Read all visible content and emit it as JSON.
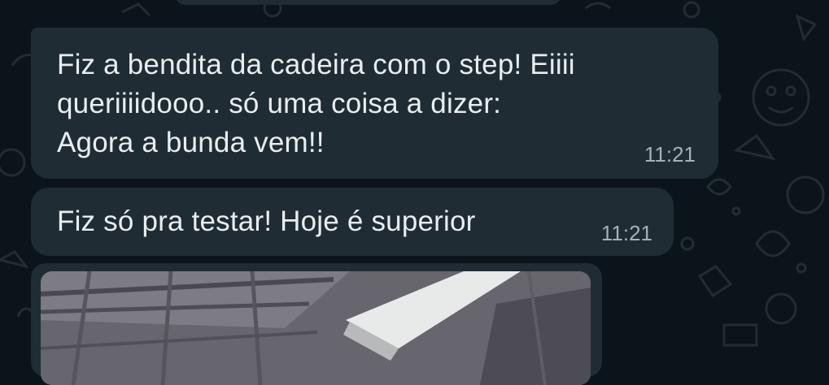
{
  "chat": {
    "messages": [
      {
        "text": "Fiz a bendita da cadeira com o step! Eiiii\nqueriiiidooo.. só uma coisa a dizer:\nAgora a bunda vem!!",
        "time": "11:21"
      },
      {
        "text": "Fiz só pra testar! Hoje é superior",
        "time": "11:21"
      }
    ],
    "image_message": {
      "type": "photo"
    }
  },
  "colors": {
    "background": "#0b141a",
    "bubble": "#1f2c34",
    "text": "#e9edef",
    "timestamp": "#a5b1b8"
  }
}
